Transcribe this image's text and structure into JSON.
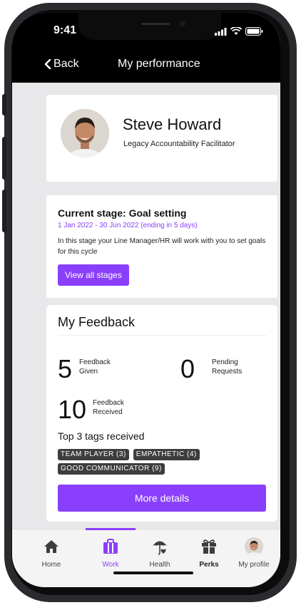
{
  "status_bar": {
    "time": "9:41"
  },
  "nav": {
    "back_label": "Back",
    "title": "My performance"
  },
  "profile": {
    "name": "Steve Howard",
    "role": "Legacy Accountability Facilitator"
  },
  "stage": {
    "title": "Current stage: Goal setting",
    "dates": "1 Jan 2022 - 30 Jun 2022 (ending in 5 days)",
    "description": "In this stage your Line Manager/HR will work with you to set goals for this cycle",
    "button_label": "View all stages"
  },
  "feedback": {
    "title": "My Feedback",
    "given": {
      "value": "5",
      "label_line1": "Feedback",
      "label_line2": "Given"
    },
    "pending": {
      "value": "0",
      "label_line1": "Pending",
      "label_line2": "Requests"
    },
    "received": {
      "value": "10",
      "label_line1": "Feedback",
      "label_line2": "Received"
    },
    "tags_title": "Top 3 tags received",
    "tags": [
      "TEAM PLAYER (3)",
      "EMPATHETIC (4)",
      "GOOD COMMUNICATOR (9)"
    ],
    "button_label": "More details"
  },
  "tabs": [
    {
      "label": "Home",
      "icon": "home-icon"
    },
    {
      "label": "Work",
      "icon": "briefcase-icon",
      "active": true
    },
    {
      "label": "Health",
      "icon": "umbrella-heart-icon"
    },
    {
      "label": "Perks",
      "icon": "gift-icon"
    },
    {
      "label": "My profile",
      "icon": "avatar"
    }
  ],
  "colors": {
    "accent": "#8a3ffc",
    "header_bg": "#000000",
    "tag_bg": "#3d3d3d"
  }
}
